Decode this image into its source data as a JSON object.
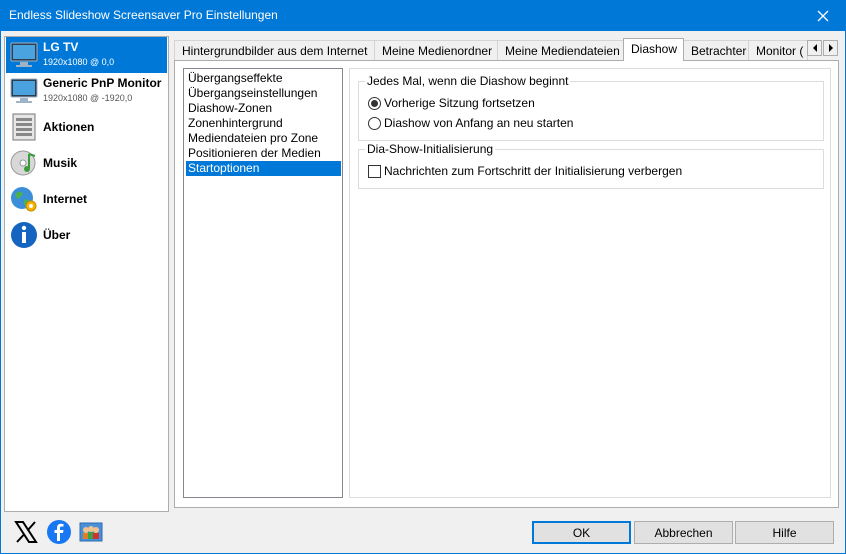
{
  "window": {
    "title": "Endless Slideshow Screensaver Pro Einstellungen"
  },
  "sidebar": {
    "items": [
      {
        "name": "LG TV",
        "sub": "1920x1080 @ 0,0",
        "icon": "monitor-icon",
        "selected": true
      },
      {
        "name": "Generic PnP Monitor",
        "sub": "1920x1080 @ -1920,0",
        "icon": "monitor-icon",
        "selected": false
      },
      {
        "name": "Aktionen",
        "icon": "actions-icon"
      },
      {
        "name": "Musik",
        "icon": "music-icon"
      },
      {
        "name": "Internet",
        "icon": "internet-icon"
      },
      {
        "name": "Über",
        "icon": "info-icon"
      }
    ]
  },
  "tabs": [
    "Hintergrundbilder aus dem Internet",
    "Meine Medienordner",
    "Meine Mediendateien",
    "Diashow",
    "Betrachter",
    "Monitor ("
  ],
  "active_tab": "Diashow",
  "categories": [
    "Übergangseffekte",
    "Übergangseinstellungen",
    "Diashow-Zonen",
    "Zonenhintergrund",
    "Mediendateien pro Zone",
    "Positionieren der Medien",
    "Startoptionen"
  ],
  "selected_category": "Startoptionen",
  "group_start": {
    "legend": "Jedes Mal, wenn die Diashow beginnt",
    "options": [
      {
        "label": "Vorherige Sitzung fortsetzen",
        "selected": true
      },
      {
        "label": "Diashow von Anfang an neu starten",
        "selected": false
      }
    ]
  },
  "group_init": {
    "legend": "Dia-Show-Initialisierung",
    "checkbox_label": "Nachrichten zum Fortschritt der Initialisierung verbergen",
    "checked": false
  },
  "footer": {
    "ok": "OK",
    "cancel": "Abbrechen",
    "help": "Hilfe",
    "social_icons": [
      "x-icon",
      "facebook-icon",
      "community-icon"
    ]
  },
  "colors": {
    "accent": "#0078d7",
    "facebook": "#1877f2"
  }
}
